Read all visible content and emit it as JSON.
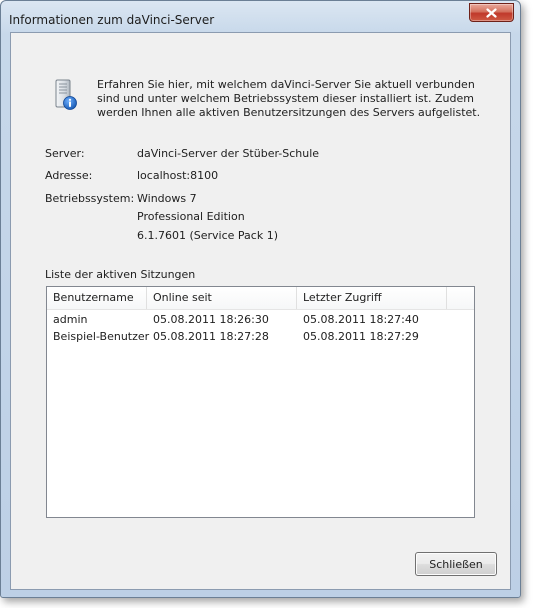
{
  "window": {
    "title": "Informationen zum daVinci-Server",
    "close_icon": "close-icon"
  },
  "intro_text": "Erfahren Sie hier, mit welchem daVinci-Server Sie aktuell verbunden sind und unter welchem Betriebssystem dieser installiert ist. Zudem werden Ihnen alle aktiven Benutzersitzungen des Servers aufgelistet.",
  "info_icon": "server-info-icon",
  "server": {
    "label": "Server:",
    "value": "daVinci-Server der Stüber-Schule"
  },
  "address": {
    "label": "Adresse:",
    "value": "localhost:8100"
  },
  "os": {
    "label": "Betriebssystem:",
    "line1": "Windows 7",
    "line2": "Professional Edition",
    "line3": "6.1.7601 (Service Pack 1)"
  },
  "sessions": {
    "heading": "Liste der aktiven Sitzungen",
    "columns": [
      "Benutzername",
      "Online seit",
      "Letzter Zugriff"
    ],
    "rows": [
      [
        "admin",
        "05.08.2011 18:26:30",
        "05.08.2011 18:27:40"
      ],
      [
        "Beispiel-Benutzer",
        "05.08.2011 18:27:28",
        "05.08.2011 18:27:29"
      ]
    ]
  },
  "buttons": {
    "close_label": "Schließen"
  },
  "colors": {
    "title_close_button": "#c0392b",
    "frame": "#bdd0e6",
    "client": "#f0f0f0",
    "icon_blue": "#1f66c2"
  }
}
